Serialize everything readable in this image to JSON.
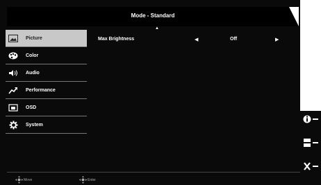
{
  "title": "Mode - Standard",
  "menu": [
    {
      "label": "Picture",
      "icon": "picture-icon",
      "active": true
    },
    {
      "label": "Color",
      "icon": "palette-icon"
    },
    {
      "label": "Audio",
      "icon": "speaker-icon"
    },
    {
      "label": "Performance",
      "icon": "performance-icon"
    },
    {
      "label": "OSD",
      "icon": "osd-icon"
    },
    {
      "label": "System",
      "icon": "gear-icon"
    }
  ],
  "setting": {
    "label": "Max Brightness",
    "value": "Off"
  },
  "footer": {
    "move": "Move",
    "enter": "Enter"
  },
  "hotkeys": [
    "info-key-icon",
    "menu-key-icon",
    "exit-key-icon"
  ]
}
